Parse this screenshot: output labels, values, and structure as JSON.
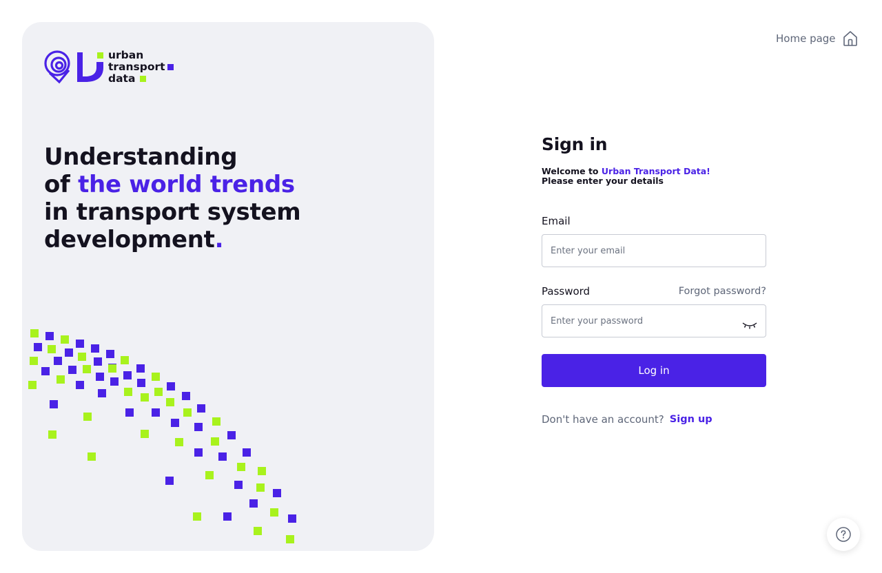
{
  "brand": {
    "logo_lines": [
      "urban",
      "transport",
      "data"
    ],
    "colors": {
      "primary": "#4a22e6",
      "accent_green": "#a8f21d"
    }
  },
  "left": {
    "headline_line1": "Understanding",
    "headline_of": "of ",
    "headline_accent": "the world trends",
    "headline_line3": "in transport system",
    "headline_line4": "development",
    "headline_dot": "."
  },
  "header": {
    "home_link_label": "Home page",
    "home_icon": "home-icon"
  },
  "form": {
    "title": "Sign in",
    "welcome_prefix": "Welcome to ",
    "welcome_brand": "Urban Transport Data!",
    "welcome_line2": "Please enter your details",
    "email_label": "Email",
    "email_placeholder": "Enter your email",
    "email_value": "",
    "password_label": "Password",
    "forgot_label": "Forgot password?",
    "password_placeholder": "Enter your password",
    "password_value": "",
    "show_password_icon": "eye-closed-icon",
    "login_label": "Log in",
    "signup_question": "Don't have an account?",
    "signup_label": "Sign up"
  },
  "help": {
    "icon": "help-icon"
  }
}
